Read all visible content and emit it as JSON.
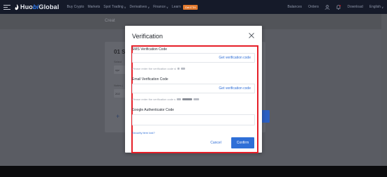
{
  "nav": {
    "logo_prefix": "Huo",
    "logo_bi": "bi",
    "logo_suffix": " Global",
    "items": [
      "Buy Crypto",
      "Markets",
      "Spot Trading",
      "Derivatives",
      "Finance",
      "Learn"
    ],
    "earn_badge": "Get ETH",
    "right_items": [
      "Balances",
      "Orders"
    ],
    "download": "Download",
    "language": "English"
  },
  "background": {
    "breadcrumb": "Creat",
    "card_title": "01 Se",
    "label1": "Select",
    "input1": "xyz",
    "label2": "Notes (",
    "input2": "202",
    "plus": "+",
    "right_hint": "o"
  },
  "modal": {
    "title": "Verification",
    "sms": {
      "label": "SMS Verification Code",
      "get_code": "Get verification code",
      "hint": "Please enter the verification code sl"
    },
    "email": {
      "label": "Email Verification Code",
      "get_code": "Get verification code",
      "hint": "Please enter the verification code s"
    },
    "ga": {
      "label": "Google Authenticator Code"
    },
    "security_lost": "Security item lost?",
    "cancel": "Cancel",
    "confirm": "Confirm"
  },
  "colors": {
    "primary": "#2f6fd7",
    "highlight": "#e61e27",
    "nav_bg": "#151a29",
    "overlay": "#5a5c63"
  }
}
